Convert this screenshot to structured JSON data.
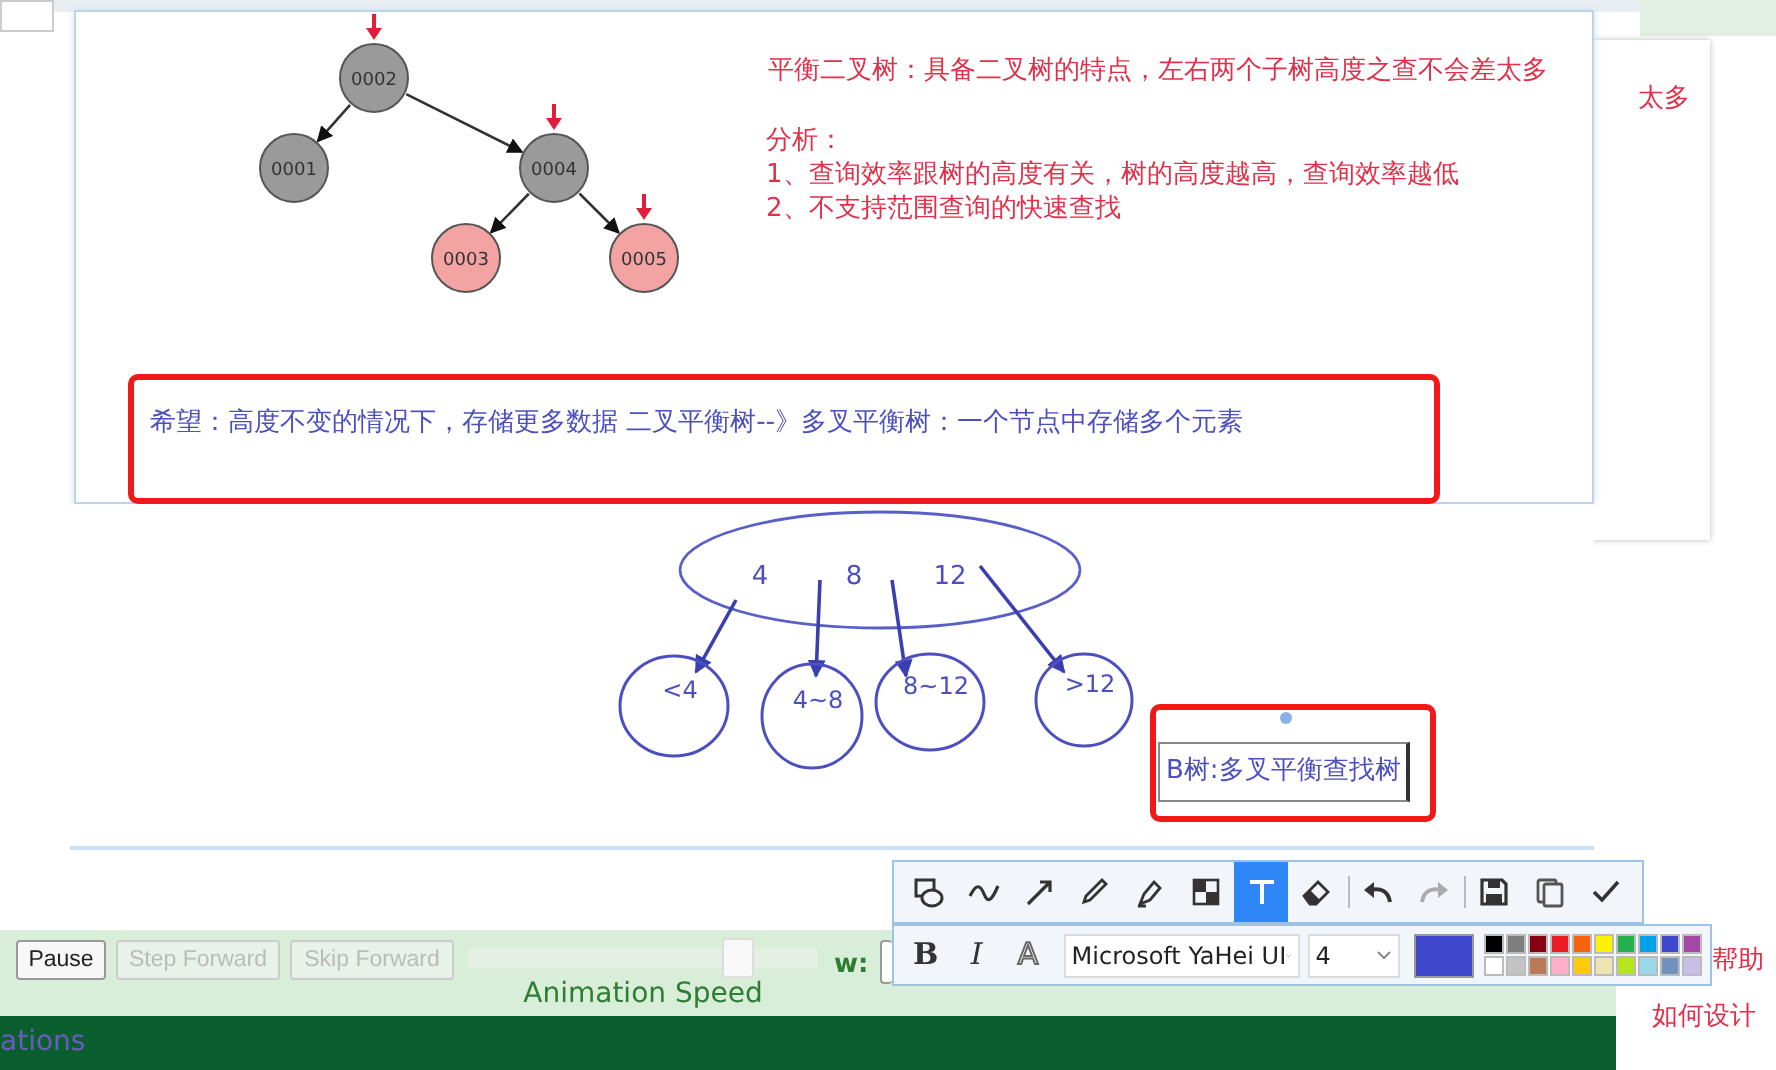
{
  "slide": {
    "tree": {
      "label": "0002",
      "color": "#9a9a9a",
      "marked": true,
      "children": [
        {
          "label": "0001",
          "color": "#9a9a9a",
          "marked": false
        },
        {
          "label": "0004",
          "color": "#9a9a9a",
          "marked": true,
          "children": [
            {
              "label": "0003",
              "color": "#f4a3a3",
              "marked": false
            },
            {
              "label": "0005",
              "color": "#f4a3a3",
              "marked": true
            }
          ]
        }
      ]
    },
    "title": "平衡二叉树：具备二叉树的特点，左右两个子树高度之查不会差太多",
    "analysis": [
      "分析：",
      "1、查询效率跟树的高度有关，树的高度越高，查询效率越低",
      "2、不支持范围查询的快速查找"
    ],
    "annotation": "希望：高度不变的情况下，存储更多数据   二叉平衡树--》多叉平衡树：一个节点中存储多个元素"
  },
  "back_panel": {
    "text": "太多"
  },
  "drawing": {
    "keys": [
      "4",
      "8",
      "12"
    ],
    "ranges": [
      "<4",
      "4~8",
      "8~12",
      ">12"
    ],
    "text_box": "B树:多叉平衡查找树"
  },
  "controls": {
    "buttons": [
      {
        "label": "Pause",
        "disabled": false
      },
      {
        "label": "Step Forward",
        "disabled": true
      },
      {
        "label": "Skip Forward",
        "disabled": true
      }
    ],
    "speed": {
      "level": 0.77,
      "label": "Animation Speed"
    },
    "w_label": "w:"
  },
  "footer": {
    "text": "ations"
  },
  "side_notes": [
    "帮助",
    "如何设计"
  ],
  "toolbar": {
    "groups": [
      [
        {
          "kind": "shape",
          "selected": false
        },
        {
          "kind": "curve",
          "selected": false
        },
        {
          "kind": "arrow",
          "selected": false
        },
        {
          "kind": "pencil",
          "selected": false
        },
        {
          "kind": "marker",
          "selected": false
        },
        {
          "kind": "mosaic",
          "selected": false
        },
        {
          "kind": "text",
          "selected": true
        },
        {
          "kind": "eraser",
          "selected": false
        }
      ],
      [
        {
          "kind": "undo",
          "disabled": false
        },
        {
          "kind": "redo",
          "disabled": true
        }
      ],
      [
        {
          "kind": "save",
          "disabled": false
        },
        {
          "kind": "copy",
          "disabled": false
        },
        {
          "kind": "done",
          "disabled": false
        }
      ]
    ]
  },
  "text_options": {
    "styles": [
      "B",
      "I",
      "A"
    ],
    "font": "Microsoft YaHei UI",
    "size": "4",
    "palette": [
      {
        "color": "#000000",
        "selected": false
      },
      {
        "color": "#7f7f7f",
        "selected": false
      },
      {
        "color": "#880015",
        "selected": false
      },
      {
        "color": "#ed1c24",
        "selected": false
      },
      {
        "color": "#f7630c",
        "selected": false
      },
      {
        "color": "#fff200",
        "selected": false
      },
      {
        "color": "#22b14c",
        "selected": false
      },
      {
        "color": "#00a2e8",
        "selected": false
      },
      {
        "color": "#3f48cc",
        "selected": true
      },
      {
        "color": "#a349a4",
        "selected": false
      },
      {
        "color": "#ffffff",
        "selected": false
      },
      {
        "color": "#c3c3c3",
        "selected": false
      },
      {
        "color": "#b97a57",
        "selected": false
      },
      {
        "color": "#ffaec9",
        "selected": false
      },
      {
        "color": "#ffc90e",
        "selected": false
      },
      {
        "color": "#efe4b0",
        "selected": false
      },
      {
        "color": "#b5e61d",
        "selected": false
      },
      {
        "color": "#99d9ea",
        "selected": false
      },
      {
        "color": "#7092be",
        "selected": false
      },
      {
        "color": "#c8bfe7",
        "selected": false
      }
    ]
  }
}
